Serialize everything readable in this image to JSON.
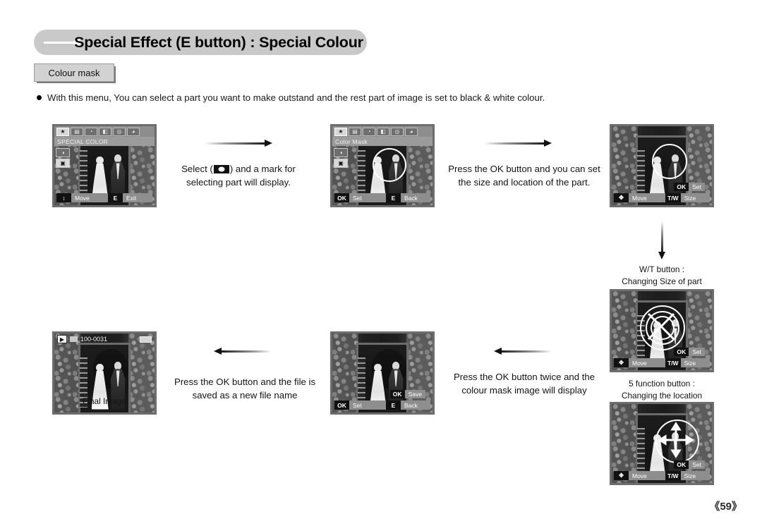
{
  "header": {
    "title": "Special Effect (E button) : Special Colour"
  },
  "subtab": {
    "label": "Colour mask"
  },
  "intro": {
    "bullet": "With this menu, You can select a part you want to make outstand and the rest part of image is set to black & white colour."
  },
  "icons": {
    "header_dash": "dash-line-icon",
    "header_dot": "dot-icon",
    "bullet": "bullet-dot-icon",
    "play": "play-icon",
    "memory_card": "memory-card-icon",
    "battery": "battery-icon",
    "chip_mask": "colour-mask-chip-icon"
  },
  "menu": {
    "tabs": [
      {
        "name": "tab-special-effect",
        "glyph": "★",
        "selected": true
      },
      {
        "name": "tab-movie",
        "glyph": "▤",
        "selected": false
      },
      {
        "name": "tab-timer",
        "glyph": "◔",
        "selected": false
      },
      {
        "name": "tab-image-edit",
        "glyph": "◧",
        "selected": false
      },
      {
        "name": "tab-camera",
        "glyph": "◎",
        "selected": false
      },
      {
        "name": "tab-palette",
        "glyph": "◕",
        "selected": false
      }
    ],
    "side_items": [
      {
        "name": "side-item-preset-focus",
        "glyph": "◑",
        "selected": false
      },
      {
        "name": "side-item-colour-mask",
        "glyph": "▣",
        "selected": true
      }
    ]
  },
  "screens": {
    "special_color": {
      "name": "special-color-menu",
      "title": "SPECIAL COLOR",
      "bottom": [
        {
          "key": "↕",
          "label": "Move"
        },
        {
          "key": "E",
          "label": "Exit"
        }
      ]
    },
    "color_mask": {
      "name": "colour-mask-menu",
      "title": "Color Mask",
      "bottom": [
        {
          "key": "OK",
          "label": "Set"
        },
        {
          "key": "E",
          "label": "Back"
        }
      ]
    },
    "set_size_location": {
      "name": "set-size-location-screen",
      "overlay": {
        "key": "OK",
        "label": "Set"
      },
      "bottom": [
        {
          "key": "✥",
          "label": "Move"
        },
        {
          "key": "T/W",
          "label": "Size"
        }
      ]
    },
    "changing_size": {
      "name": "changing-size-screen",
      "overlay": {
        "key": "OK",
        "label": "Set"
      },
      "bottom": [
        {
          "key": "✥",
          "label": "Move"
        },
        {
          "key": "T/W",
          "label": "Size"
        }
      ]
    },
    "changing_location": {
      "name": "changing-location-screen",
      "overlay": {
        "key": "OK",
        "label": "Set"
      },
      "bottom": [
        {
          "key": "✥",
          "label": "Move"
        },
        {
          "key": "T/W",
          "label": "Size"
        }
      ]
    },
    "save_screen": {
      "name": "save-screen",
      "overlay": {
        "key": "OK",
        "label": "Save"
      },
      "bottom": [
        {
          "key": "OK",
          "label": "Set"
        },
        {
          "key": "E",
          "label": "Back"
        }
      ]
    },
    "final_image": {
      "name": "final-image-screen",
      "file_number": "100-0031"
    }
  },
  "captions": {
    "step1_line1": "Select (",
    "step1_line1b": ") and a mark for",
    "step1_line2": "selecting part will display.",
    "step2_line1": "Press the OK button and you can set",
    "step2_line2": "the size and location of the part.",
    "wt_line1": "W/T button :",
    "wt_line2": "Changing Size of part",
    "fn_line1": "5 function button :",
    "fn_line2": "Changing the location",
    "step3_line1": "Press the OK button twice and the",
    "step3_line2": "colour mask image will display",
    "step4_line1": "Press the OK button and the file is",
    "step4_line2": "saved as a new file name",
    "final_label": "Final Image"
  },
  "footer": {
    "page": "《59》"
  }
}
